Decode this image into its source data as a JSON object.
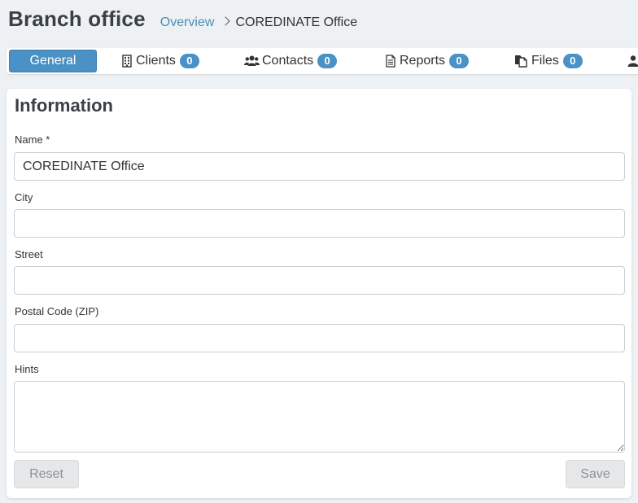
{
  "header": {
    "title": "Branch office",
    "breadcrumb": {
      "link": "Overview",
      "current": "COREDINATE Office"
    }
  },
  "tabs": [
    {
      "label": "General",
      "icon": "none"
    },
    {
      "label": "Clients",
      "icon": "building-icon",
      "count": "0"
    },
    {
      "label": "Contacts",
      "icon": "users-icon",
      "count": "0"
    },
    {
      "label": "Reports",
      "icon": "document-icon",
      "count": "0"
    },
    {
      "label": "Files",
      "icon": "files-icon",
      "count": "0"
    },
    {
      "label": "",
      "icon": "user-icon"
    }
  ],
  "form": {
    "title": "Information",
    "fields": {
      "name": {
        "label": "Name *",
        "value": "COREDINATE Office"
      },
      "city": {
        "label": "City",
        "value": ""
      },
      "street": {
        "label": "Street",
        "value": ""
      },
      "zip": {
        "label": "Postal Code (ZIP)",
        "value": ""
      },
      "hints": {
        "label": "Hints",
        "value": ""
      }
    },
    "reset_label": "Reset",
    "save_label": "Save"
  },
  "colors": {
    "accent": "#4a91c6",
    "link": "#4a8db4",
    "background": "#eef1f4",
    "disabled_button": "#e6e7e8"
  }
}
